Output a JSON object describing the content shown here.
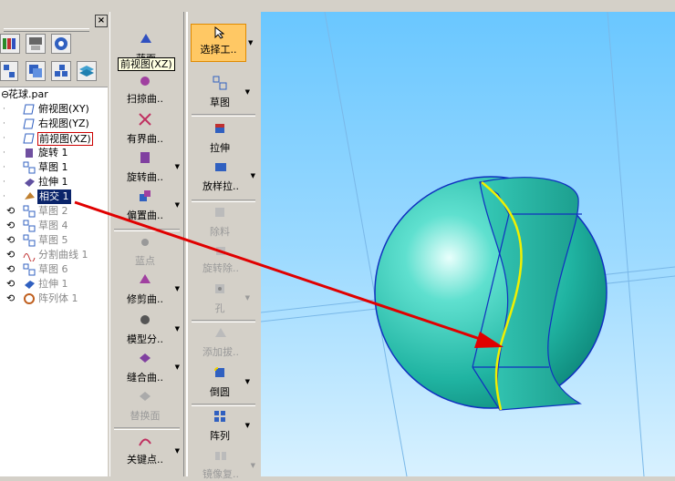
{
  "panel": {
    "close_label": "×",
    "tree": [
      {
        "label": "花球.par",
        "type": "root",
        "state": "normal"
      },
      {
        "label": "俯视图(XY)",
        "type": "plane",
        "state": "normal"
      },
      {
        "label": "右视图(YZ)",
        "type": "plane",
        "state": "normal"
      },
      {
        "label": "前视图(XZ)",
        "type": "plane",
        "state": "boxed"
      },
      {
        "label": "旋转 1",
        "type": "feature",
        "state": "normal"
      },
      {
        "label": "草图 1",
        "type": "sketch",
        "state": "normal"
      },
      {
        "label": "拉伸 1",
        "type": "feature",
        "state": "normal"
      },
      {
        "label": "相交 1",
        "type": "feature",
        "state": "selected"
      },
      {
        "label": "草图 2",
        "type": "sketch",
        "state": "rolled"
      },
      {
        "label": "草图 4",
        "type": "sketch",
        "state": "rolled"
      },
      {
        "label": "草图 5",
        "type": "sketch",
        "state": "rolled"
      },
      {
        "label": "分割曲线 1",
        "type": "curve",
        "state": "rolled"
      },
      {
        "label": "草图 6",
        "type": "sketch",
        "state": "rolled"
      },
      {
        "label": "拉伸 1",
        "type": "feature",
        "state": "rolled"
      },
      {
        "label": "阵列体 1",
        "type": "feature",
        "state": "rolled"
      }
    ]
  },
  "toolbar1": {
    "tooltip": "前视图(XZ)",
    "buttons": [
      {
        "label": "蓝面",
        "enabled": true
      },
      {
        "label": "扫掠曲..",
        "enabled": true
      },
      {
        "label": "有界曲..",
        "enabled": true
      },
      {
        "label": "旋转曲..",
        "enabled": true
      },
      {
        "label": "偏置曲..",
        "enabled": true
      },
      {
        "label": "蓝点",
        "enabled": false
      },
      {
        "label": "修剪曲..",
        "enabled": true
      },
      {
        "label": "模型分..",
        "enabled": true
      },
      {
        "label": "缝合曲..",
        "enabled": true
      },
      {
        "label": "替换面",
        "enabled": false
      },
      {
        "label": "关键点..",
        "enabled": true
      }
    ]
  },
  "toolbar2": {
    "buttons": [
      {
        "label": "选择工..",
        "enabled": true
      },
      {
        "label": "草图",
        "enabled": true
      },
      {
        "label": "拉伸",
        "enabled": true
      },
      {
        "label": "放样拉..",
        "enabled": true
      },
      {
        "label": "除料",
        "enabled": false
      },
      {
        "label": "旋转除..",
        "enabled": false
      },
      {
        "label": "孔",
        "enabled": false
      },
      {
        "label": "添加拔..",
        "enabled": false
      },
      {
        "label": "倒圆",
        "enabled": true
      },
      {
        "label": "阵列",
        "enabled": true
      },
      {
        "label": "镜像复..",
        "enabled": false
      }
    ]
  },
  "colors": {
    "sphere": "#28c0b0",
    "edge": "#1030c0",
    "highlight_curve": "#f0f000",
    "arrow": "#e00000",
    "viewport_bg": "#8fd4ff"
  }
}
